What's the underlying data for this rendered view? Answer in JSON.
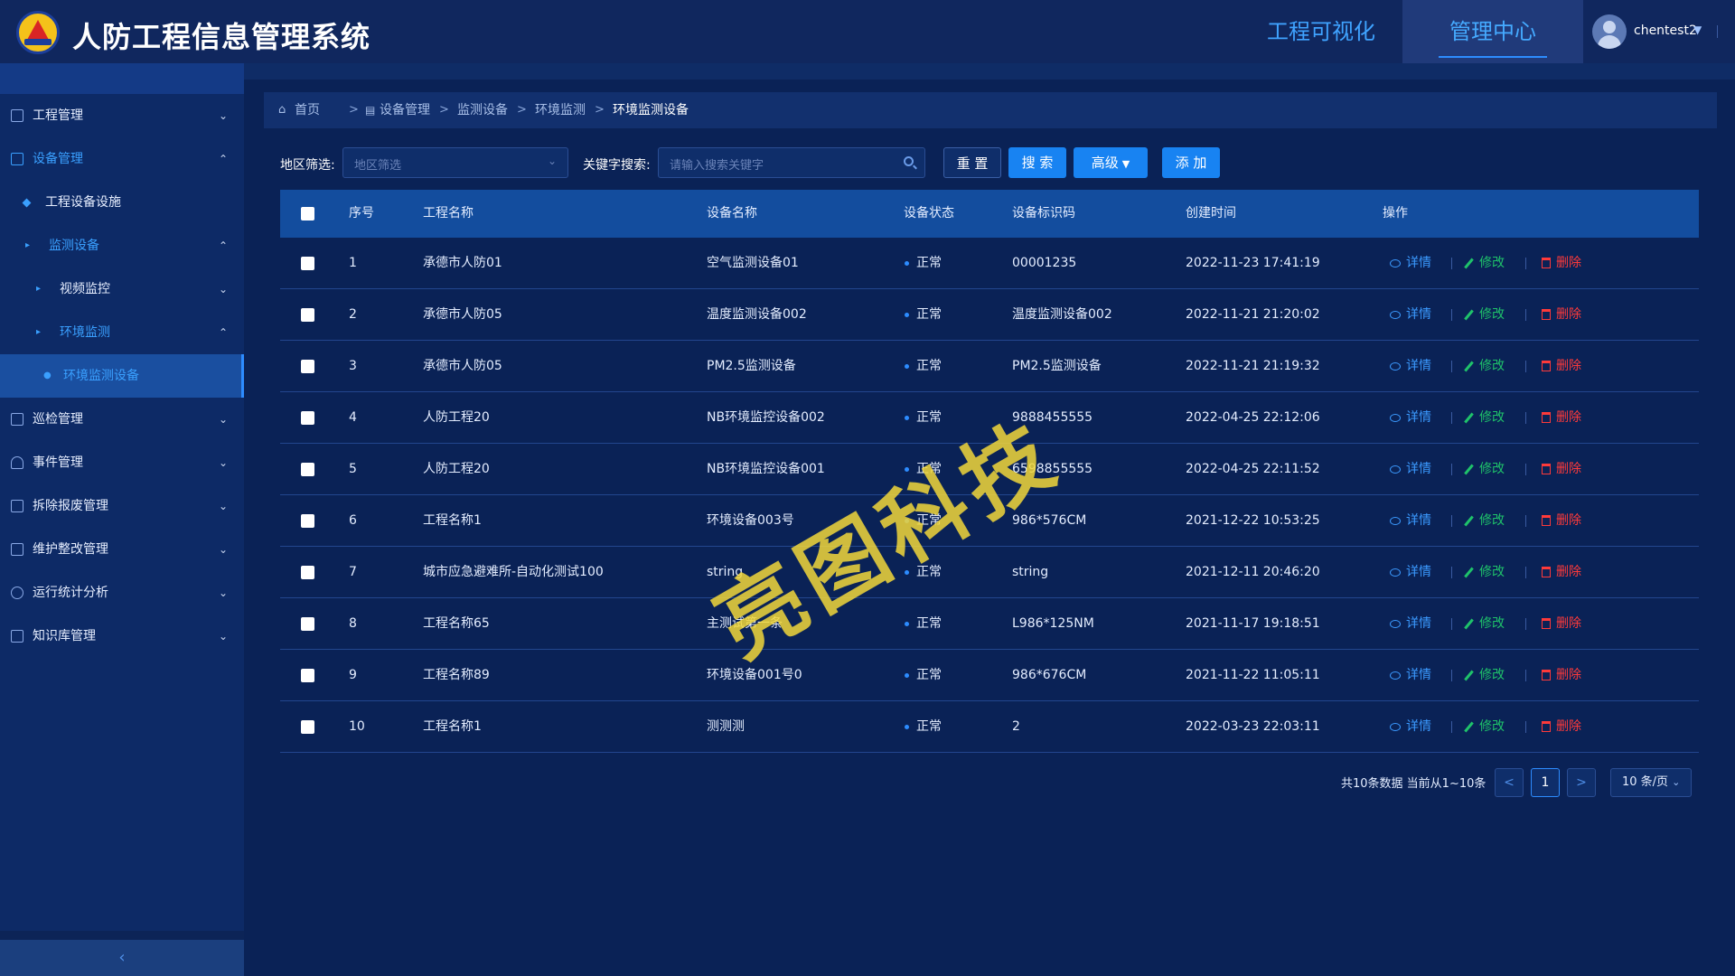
{
  "header": {
    "title": "人防工程信息管理系统",
    "nav": [
      {
        "label": "工程可视化"
      },
      {
        "label": "管理中心"
      }
    ],
    "user": "chentest2"
  },
  "sidebar": {
    "items": [
      {
        "label": "工程管理"
      },
      {
        "label": "设备管理"
      },
      {
        "label": "工程设备设施"
      },
      {
        "label": "监测设备"
      },
      {
        "label": "视频监控"
      },
      {
        "label": "环境监测"
      },
      {
        "label": "环境监测设备"
      },
      {
        "label": "巡检管理"
      },
      {
        "label": "事件管理"
      },
      {
        "label": "拆除报废管理"
      },
      {
        "label": "维护整改管理"
      },
      {
        "label": "运行统计分析"
      },
      {
        "label": "知识库管理"
      }
    ]
  },
  "breadcrumb": [
    "首页",
    "设备管理",
    "监测设备",
    "环境监测",
    "环境监测设备"
  ],
  "filters": {
    "region_label": "地区筛选:",
    "region_placeholder": "地区筛选",
    "keyword_label": "关键字搜索:",
    "keyword_placeholder": "请输入搜索关键字"
  },
  "buttons": {
    "reset": "重 置",
    "search": "搜 索",
    "advanced": "高级",
    "add": "添 加"
  },
  "table": {
    "headers": [
      "序号",
      "工程名称",
      "设备名称",
      "设备状态",
      "设备标识码",
      "创建时间",
      "操作"
    ],
    "actions": {
      "view": "详情",
      "edit": "修改",
      "delete": "删除"
    },
    "rows": [
      {
        "no": "1",
        "project": "承德市人防01",
        "device": "空气监测设备01",
        "status": "正常",
        "code": "00001235",
        "time": "2022-11-23 17:41:19"
      },
      {
        "no": "2",
        "project": "承德市人防05",
        "device": "温度监测设备002",
        "status": "正常",
        "code": "温度监测设备002",
        "time": "2022-11-21 21:20:02"
      },
      {
        "no": "3",
        "project": "承德市人防05",
        "device": "PM2.5监测设备",
        "status": "正常",
        "code": "PM2.5监测设备",
        "time": "2022-11-21 21:19:32"
      },
      {
        "no": "4",
        "project": "人防工程20",
        "device": "NB环境监控设备002",
        "status": "正常",
        "code": "9888455555",
        "time": "2022-04-25 22:12:06"
      },
      {
        "no": "5",
        "project": "人防工程20",
        "device": "NB环境监控设备001",
        "status": "正常",
        "code": "6598855555",
        "time": "2022-04-25 22:11:52"
      },
      {
        "no": "6",
        "project": "工程名称1",
        "device": "环境设备003号",
        "status": "正常",
        "code": "986*576CM",
        "time": "2021-12-22 10:53:25"
      },
      {
        "no": "7",
        "project": "城市应急避难所-自动化测试100",
        "device": "string",
        "status": "正常",
        "code": "string",
        "time": "2021-12-11 20:46:20"
      },
      {
        "no": "8",
        "project": "工程名称65",
        "device": "主测试第一条",
        "status": "正常",
        "code": "L986*125NM",
        "time": "2021-11-17 19:18:51"
      },
      {
        "no": "9",
        "project": "工程名称89",
        "device": "环境设备001号0",
        "status": "正常",
        "code": "986*676CM",
        "time": "2021-11-22 11:05:11"
      },
      {
        "no": "10",
        "project": "工程名称1",
        "device": "测测测",
        "status": "正常",
        "code": "2",
        "time": "2022-03-23 22:03:11"
      }
    ]
  },
  "pagination": {
    "total_text": "共10条数据 当前从1~10条",
    "prev": "<",
    "current": "1",
    "next": ">",
    "page_size": "10 条/页"
  },
  "watermark": "亮图科技"
}
